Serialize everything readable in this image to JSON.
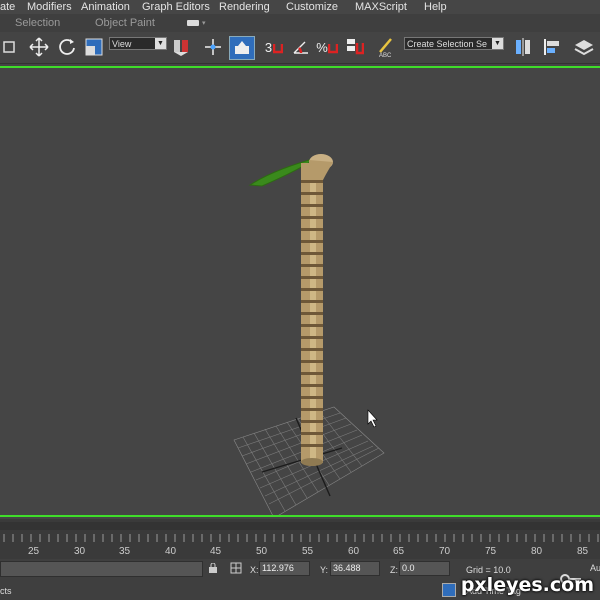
{
  "menu": [
    {
      "label": "ate"
    },
    {
      "label": "Modifiers"
    },
    {
      "label": "Animation"
    },
    {
      "label": "Graph Editors"
    },
    {
      "label": "Rendering"
    },
    {
      "label": "Customize"
    },
    {
      "label": "MAXScript"
    },
    {
      "label": "Help"
    }
  ],
  "ribbon": {
    "selection": "Selection",
    "object_paint": "Object Paint"
  },
  "toolbar": {
    "ref_coord": "View",
    "snap_angle": "3",
    "named_selection": "Create Selection Se",
    "percent_snap": "%"
  },
  "timeline": {
    "ticks": [
      "25",
      "30",
      "35",
      "40",
      "45",
      "50",
      "55",
      "60",
      "65",
      "70",
      "75",
      "80",
      "85"
    ]
  },
  "status": {
    "left_text": "cts",
    "x_label": "X:",
    "x_value": "112.976",
    "y_label": "Y:",
    "y_value": "36.488",
    "z_label": "Z:",
    "z_value": "0.0",
    "grid": "Grid = 10.0",
    "add_time_tag": "Add Time Tag",
    "auto_key": "Au"
  },
  "watermark": "pxleyes.com",
  "colors": {
    "viewport_border": "#3fdd2a",
    "viewport_bg": "#454545",
    "active_button": "#2f6dbb"
  }
}
